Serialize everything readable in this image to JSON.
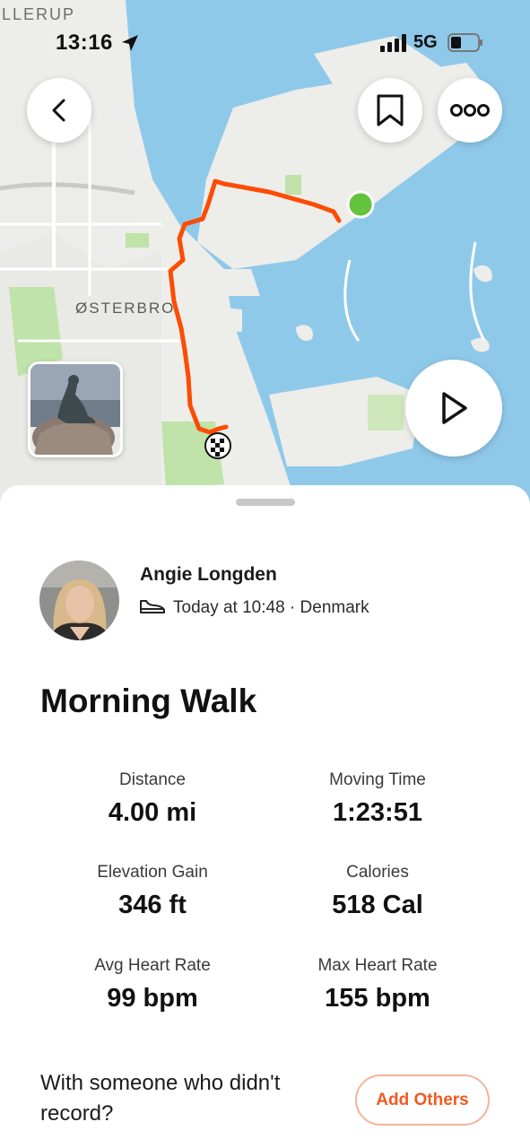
{
  "status_bar": {
    "time": "13:16",
    "network": "5G"
  },
  "map": {
    "labels": {
      "top_left": "LLERUP",
      "district": "ØSTERBRO"
    },
    "route_color": "#fc4c02",
    "start_marker_color": "#63c33a",
    "water_color": "#8fc9ea",
    "land_color": "#eeeeea"
  },
  "map_controls": {
    "back_icon": "chevron-left-icon",
    "bookmark_icon": "bookmark-icon",
    "more_icon": "more-dots-icon",
    "play_icon": "play-icon"
  },
  "athlete": {
    "name": "Angie Longden",
    "activity_icon": "shoe-icon",
    "meta": "Today at 10:48 · Denmark"
  },
  "activity": {
    "title": "Morning Walk"
  },
  "stats": [
    {
      "label": "Distance",
      "value": "4.00 mi"
    },
    {
      "label": "Moving Time",
      "value": "1:23:51"
    },
    {
      "label": "Elevation Gain",
      "value": "346 ft"
    },
    {
      "label": "Calories",
      "value": "518 Cal"
    },
    {
      "label": "Avg Heart Rate",
      "value": "99 bpm"
    },
    {
      "label": "Max Heart Rate",
      "value": "155 bpm"
    }
  ],
  "companions": {
    "prompt": "With someone who didn't record?",
    "button_label": "Add Others",
    "accent": "#f05a22"
  }
}
